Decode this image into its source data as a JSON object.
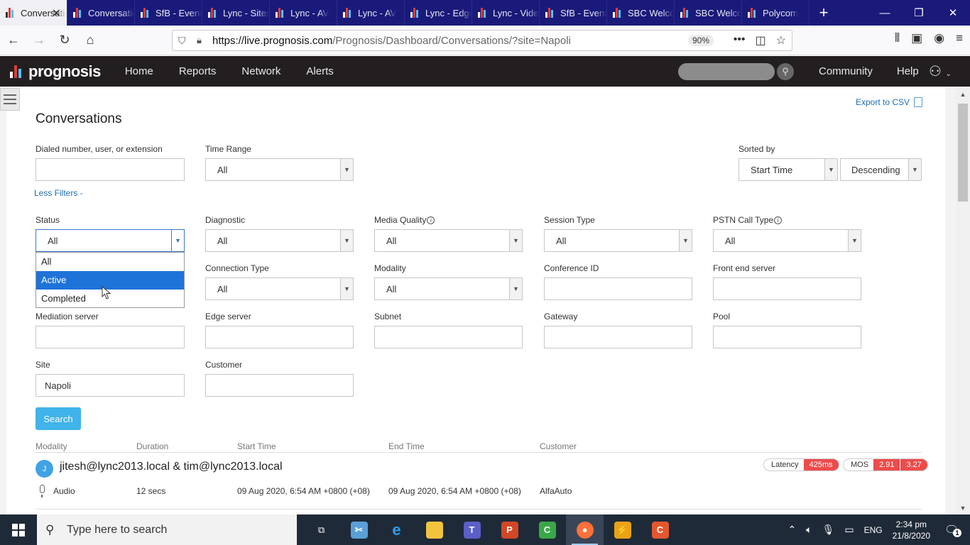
{
  "browser": {
    "tabs": [
      {
        "label": "Conversations",
        "active": true
      },
      {
        "label": "Conversations"
      },
      {
        "label": "SfB - Events"
      },
      {
        "label": "Lync - Sites"
      },
      {
        "label": "Lync - AV"
      },
      {
        "label": "Lync - AV"
      },
      {
        "label": "Lync - Edge"
      },
      {
        "label": "Lync - Video"
      },
      {
        "label": "SfB - Events"
      },
      {
        "label": "SBC Welcome"
      },
      {
        "label": "SBC Welcome"
      },
      {
        "label": "Polycom"
      }
    ],
    "url_host": "https://live.prognosis.com",
    "url_path": "/Prognosis/Dashboard/Conversations/?site=Napoli",
    "zoom": "90%"
  },
  "app": {
    "brand": "prognosis",
    "nav": [
      "Home",
      "Reports",
      "Network",
      "Alerts"
    ],
    "header_links": [
      "Community",
      "Help"
    ]
  },
  "page": {
    "export_label": "Export to CSV",
    "title": "Conversations",
    "less_filters": "Less Filters -",
    "search_button": "Search"
  },
  "filters": {
    "dialed": {
      "label": "Dialed number, user, or extension",
      "value": ""
    },
    "time_range": {
      "label": "Time Range",
      "value": "All"
    },
    "sorted_by": {
      "label": "Sorted by",
      "field": "Start Time",
      "order": "Descending"
    },
    "status": {
      "label": "Status",
      "value": "All",
      "options": [
        "All",
        "Active",
        "Completed"
      ],
      "highlighted": "Active"
    },
    "diagnostic": {
      "label": "Diagnostic",
      "value": "All"
    },
    "media_quality": {
      "label": "Media Quality",
      "value": "All"
    },
    "session_type": {
      "label": "Session Type",
      "value": "All"
    },
    "pstn_call_type": {
      "label": "PSTN Call Type",
      "value": "All"
    },
    "connection_type": {
      "label": "Connection Type",
      "value": "All"
    },
    "modality": {
      "label": "Modality",
      "value": "All"
    },
    "conference_id": {
      "label": "Conference ID",
      "value": ""
    },
    "front_end_server": {
      "label": "Front end server",
      "value": ""
    },
    "mediation_server": {
      "label": "Mediation server",
      "value": ""
    },
    "edge_server": {
      "label": "Edge server",
      "value": ""
    },
    "subnet": {
      "label": "Subnet",
      "value": ""
    },
    "gateway": {
      "label": "Gateway",
      "value": ""
    },
    "pool": {
      "label": "Pool",
      "value": ""
    },
    "site": {
      "label": "Site",
      "value": "Napoli"
    },
    "customer": {
      "label": "Customer",
      "value": ""
    }
  },
  "results": {
    "columns": [
      "Modality",
      "Duration",
      "Start Time",
      "End Time",
      "Customer"
    ],
    "rows": [
      {
        "initial": "J",
        "title": "jitesh@lync2013.local & tim@lync2013.local",
        "modality": "Audio",
        "duration": "12 secs",
        "start": "09 Aug 2020, 6:54 AM +0800 (+08)",
        "end": "09 Aug 2020, 6:54 AM +0800 (+08)",
        "customer": "AlfaAuto",
        "latency_label": "Latency",
        "latency": "425ms",
        "mos_label": "MOS",
        "mos": [
          "2.91",
          "3.27"
        ]
      }
    ]
  },
  "taskbar": {
    "search_placeholder": "Type here to search",
    "language": "ENG",
    "time": "2:34 pm",
    "date": "21/8/2020",
    "notifications": "1"
  },
  "colors": {
    "tabbar": "#1a1a7a",
    "app_header": "#231f20",
    "accent_link": "#1f6fb8",
    "search_button": "#3fb3ea",
    "highlight": "#1e73d9",
    "bad_metric": "#ee4b4b"
  }
}
